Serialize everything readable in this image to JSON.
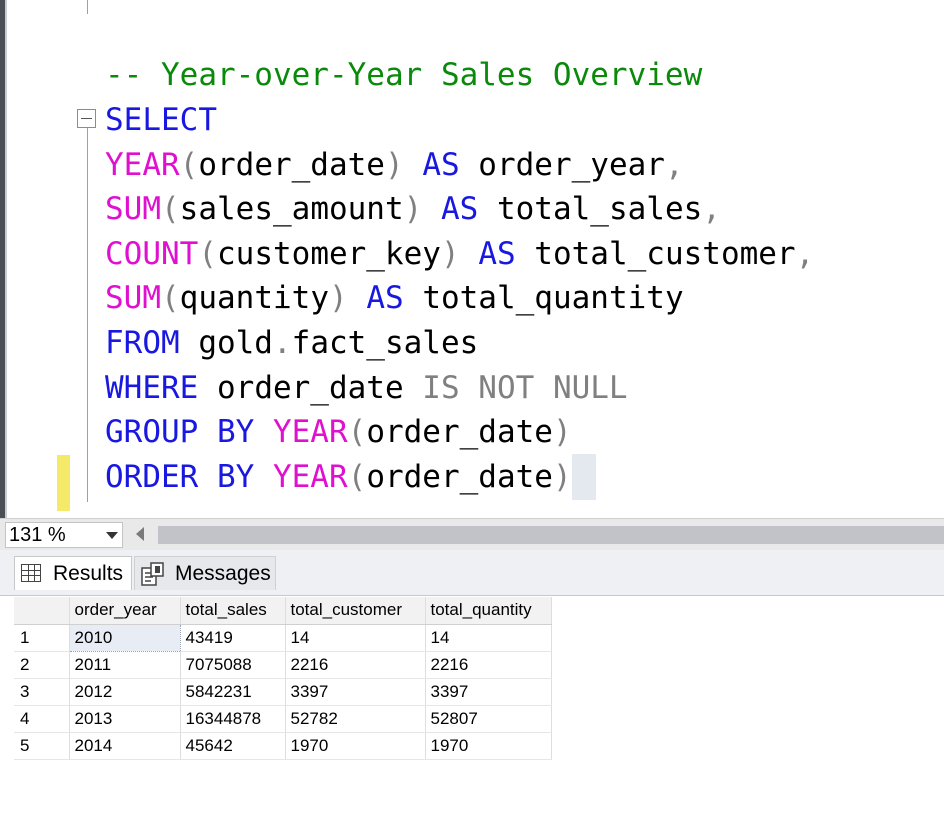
{
  "editor": {
    "comment": "-- Year-over-Year Sales Overview",
    "lines": [
      {
        "id": "select",
        "tokens": [
          {
            "t": "SELECT",
            "k": "keyword"
          }
        ]
      },
      {
        "id": "year",
        "tokens": [
          {
            "t": "YEAR",
            "k": "func"
          },
          {
            "t": "(",
            "k": "gray"
          },
          {
            "t": "order_date",
            "k": "plain"
          },
          {
            "t": ")",
            "k": "gray"
          },
          {
            "t": " ",
            "k": "plain"
          },
          {
            "t": "AS",
            "k": "keyword"
          },
          {
            "t": " order_year",
            "k": "plain"
          },
          {
            "t": ",",
            "k": "gray"
          }
        ]
      },
      {
        "id": "sum-sales",
        "tokens": [
          {
            "t": "SUM",
            "k": "func"
          },
          {
            "t": "(",
            "k": "gray"
          },
          {
            "t": "sales_amount",
            "k": "plain"
          },
          {
            "t": ")",
            "k": "gray"
          },
          {
            "t": " ",
            "k": "plain"
          },
          {
            "t": "AS",
            "k": "keyword"
          },
          {
            "t": " total_sales",
            "k": "plain"
          },
          {
            "t": ",",
            "k": "gray"
          }
        ]
      },
      {
        "id": "count",
        "tokens": [
          {
            "t": "COUNT",
            "k": "func"
          },
          {
            "t": "(",
            "k": "gray"
          },
          {
            "t": "customer_key",
            "k": "plain"
          },
          {
            "t": ")",
            "k": "gray"
          },
          {
            "t": " ",
            "k": "plain"
          },
          {
            "t": "AS",
            "k": "keyword"
          },
          {
            "t": " total_customer",
            "k": "plain"
          },
          {
            "t": ",",
            "k": "gray"
          }
        ]
      },
      {
        "id": "sum-qty",
        "tokens": [
          {
            "t": "SUM",
            "k": "func"
          },
          {
            "t": "(",
            "k": "gray"
          },
          {
            "t": "quantity",
            "k": "plain"
          },
          {
            "t": ")",
            "k": "gray"
          },
          {
            "t": " ",
            "k": "plain"
          },
          {
            "t": "AS",
            "k": "keyword"
          },
          {
            "t": " total_quantity",
            "k": "plain"
          }
        ]
      },
      {
        "id": "from",
        "tokens": [
          {
            "t": "FROM",
            "k": "keyword"
          },
          {
            "t": " gold",
            "k": "plain"
          },
          {
            "t": ".",
            "k": "gray"
          },
          {
            "t": "fact_sales",
            "k": "plain"
          }
        ]
      },
      {
        "id": "where",
        "tokens": [
          {
            "t": "WHERE",
            "k": "keyword"
          },
          {
            "t": " order_date ",
            "k": "plain"
          },
          {
            "t": "IS NOT NULL",
            "k": "gray"
          }
        ]
      },
      {
        "id": "group",
        "tokens": [
          {
            "t": "GROUP BY",
            "k": "keyword"
          },
          {
            "t": " ",
            "k": "plain"
          },
          {
            "t": "YEAR",
            "k": "func"
          },
          {
            "t": "(",
            "k": "gray"
          },
          {
            "t": "order_date",
            "k": "plain"
          },
          {
            "t": ")",
            "k": "gray"
          }
        ]
      },
      {
        "id": "order",
        "tokens": [
          {
            "t": "ORDER BY",
            "k": "keyword"
          },
          {
            "t": " ",
            "k": "plain"
          },
          {
            "t": "YEAR",
            "k": "func"
          },
          {
            "t": "(",
            "k": "gray"
          },
          {
            "t": "order_date",
            "k": "plain"
          },
          {
            "t": ")",
            "k": "gray"
          }
        ]
      }
    ]
  },
  "status": {
    "zoom": "131 %"
  },
  "tabs": {
    "results": "Results",
    "messages": "Messages"
  },
  "results": {
    "columns": [
      "",
      "order_year",
      "total_sales",
      "total_customer",
      "total_quantity"
    ],
    "rows": [
      [
        "1",
        "2010",
        "43419",
        "14",
        "14"
      ],
      [
        "2",
        "2011",
        "7075088",
        "2216",
        "2216"
      ],
      [
        "3",
        "2012",
        "5842231",
        "3397",
        "3397"
      ],
      [
        "4",
        "2013",
        "16344878",
        "52782",
        "52807"
      ],
      [
        "5",
        "2014",
        "45642",
        "1970",
        "1970"
      ]
    ]
  },
  "colors": {
    "keyword": "#1818e0",
    "function": "#e010d0",
    "comment": "#0a8a0a",
    "operator": "#808080"
  }
}
